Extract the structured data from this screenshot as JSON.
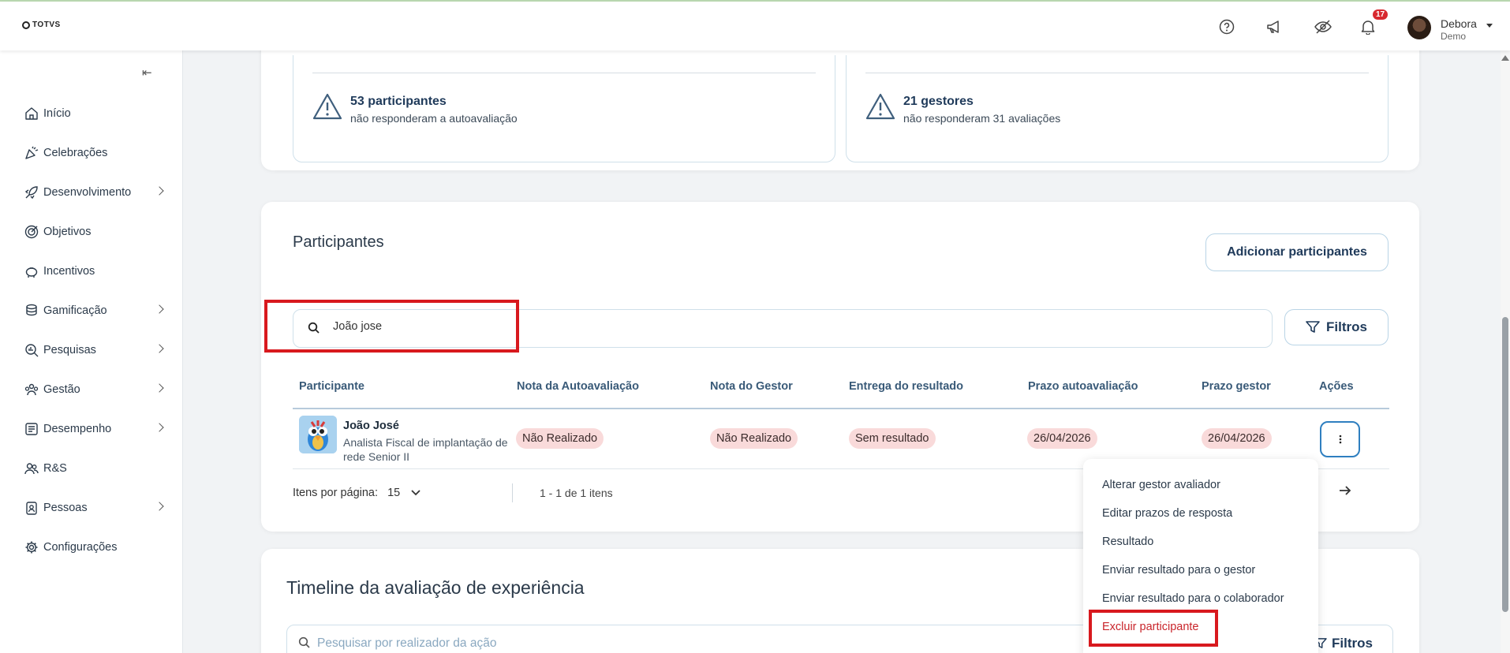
{
  "header": {
    "logo_text": "TOTVS",
    "notifications_count": "17",
    "user_name": "Debora",
    "user_role": "Demo"
  },
  "sidebar": {
    "items": [
      {
        "label": "Início",
        "icon": "home-icon",
        "expandable": false
      },
      {
        "label": "Celebrações",
        "icon": "party-icon",
        "expandable": false
      },
      {
        "label": "Desenvolvimento",
        "icon": "rocket-icon",
        "expandable": true
      },
      {
        "label": "Objetivos",
        "icon": "target-icon",
        "expandable": false
      },
      {
        "label": "Incentivos",
        "icon": "piggy-bank-icon",
        "expandable": false
      },
      {
        "label": "Gamificação",
        "icon": "coins-icon",
        "expandable": true
      },
      {
        "label": "Pesquisas",
        "icon": "search-chart-icon",
        "expandable": true
      },
      {
        "label": "Gestão",
        "icon": "team-icon",
        "expandable": true
      },
      {
        "label": "Desempenho",
        "icon": "list-check-icon",
        "expandable": true
      },
      {
        "label": "R&S",
        "icon": "people-icon",
        "expandable": false
      },
      {
        "label": "Pessoas",
        "icon": "badge-icon",
        "expandable": true
      },
      {
        "label": "Configurações",
        "icon": "gear-icon",
        "expandable": false
      }
    ]
  },
  "summary": {
    "participants": {
      "count_text": "53 participantes",
      "sub_text": "não responderam a autoavaliação"
    },
    "managers": {
      "count_text": "21 gestores",
      "sub_text": "não responderam 31 avaliações"
    }
  },
  "participants_section": {
    "title": "Participantes",
    "add_button": "Adicionar participantes",
    "filters_button": "Filtros",
    "search_value": "João jose",
    "columns": [
      "Participante",
      "Nota da Autoavaliação",
      "Nota do Gestor",
      "Entrega do resultado",
      "Prazo autoavaliação",
      "Prazo gestor",
      "Ações"
    ],
    "rows": [
      {
        "name": "João José",
        "role": "Analista Fiscal de implantação de rede Senior II",
        "self_score": "Não Realizado",
        "manager_score": "Não Realizado",
        "result_delivery": "Sem resultado",
        "self_deadline": "26/04/2026",
        "manager_deadline": "26/04/2026"
      }
    ],
    "pager": {
      "label": "Itens por página:",
      "page_size": "15",
      "count": "1 - 1 de 1 itens"
    }
  },
  "actions_menu": {
    "items": [
      "Alterar gestor avaliador",
      "Editar prazos de resposta",
      "Resultado",
      "Enviar resultado para o gestor",
      "Enviar resultado para o colaborador",
      "Excluir participante"
    ]
  },
  "timeline_section": {
    "title": "Timeline da avaliação de experiência",
    "search_placeholder": "Pesquisar por realizador da ação",
    "filters_button": "Filtros"
  },
  "colors": {
    "accent": "#2f7fc0",
    "highlight": "#d8191e",
    "danger": "#c9252b",
    "tag_bg": "#f9dada"
  }
}
